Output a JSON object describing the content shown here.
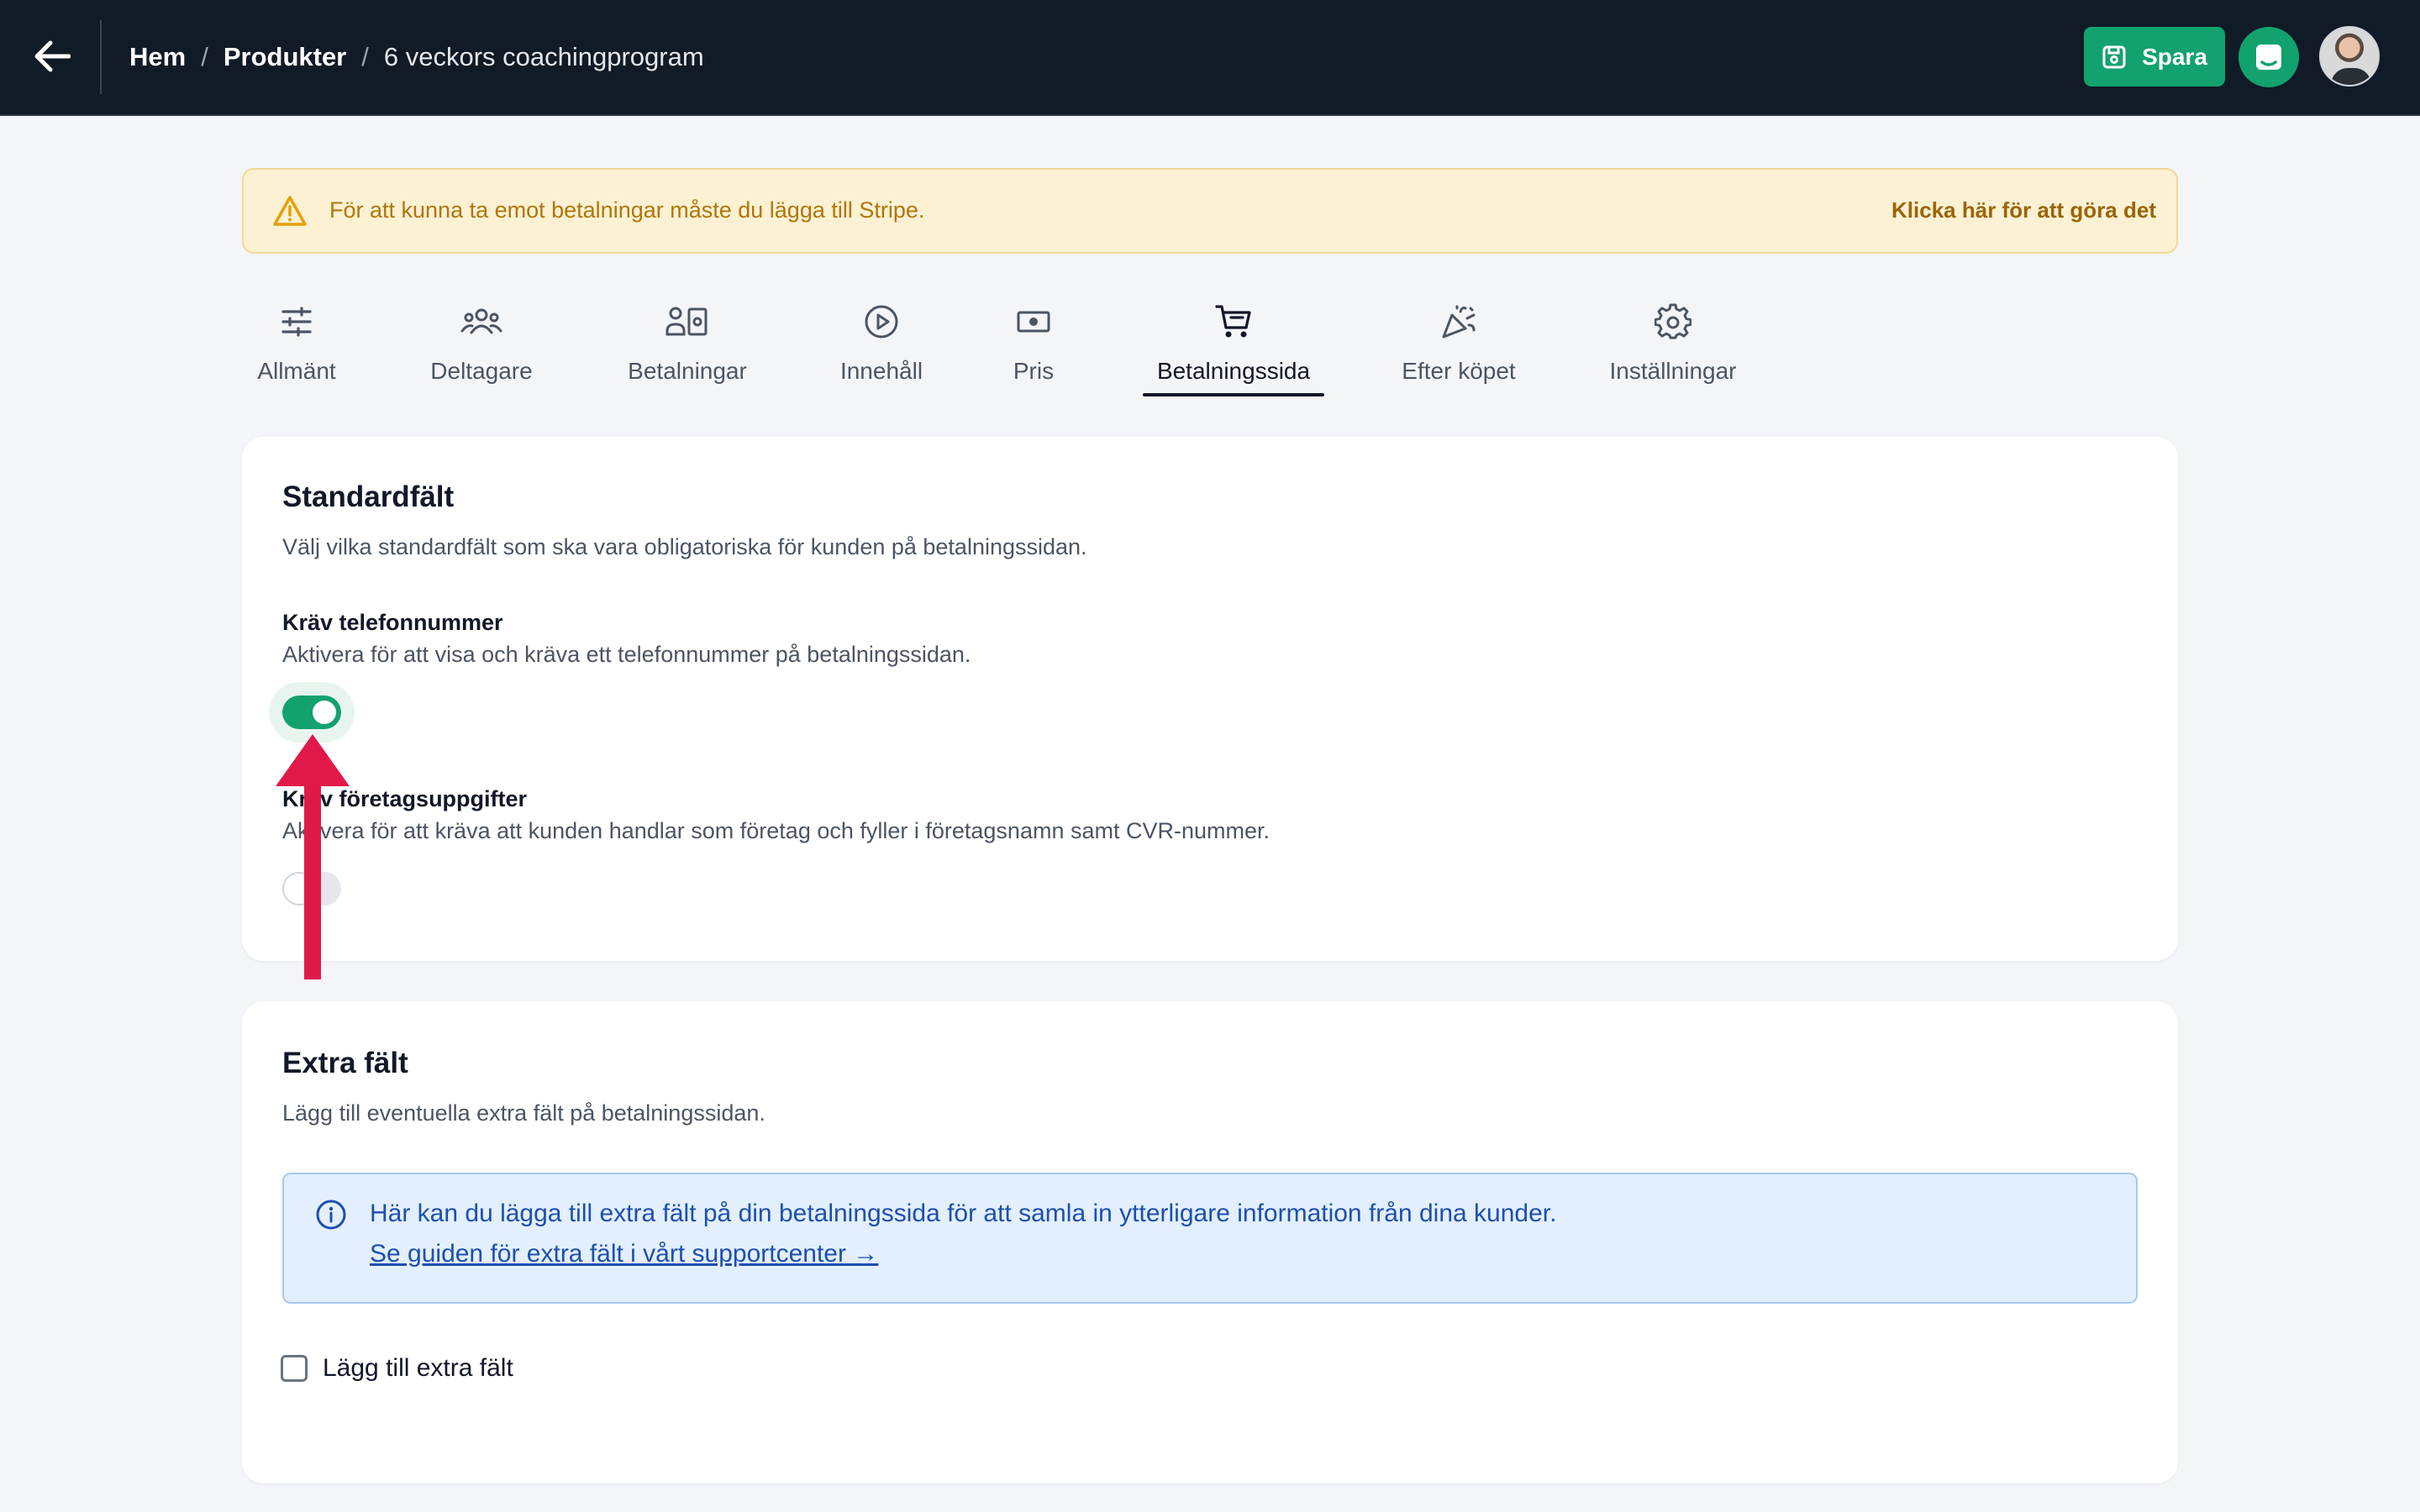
{
  "header": {
    "breadcrumb": [
      "Hem",
      "Produkter",
      "6 veckors coachingprogram"
    ],
    "save_label": "Spara"
  },
  "alert": {
    "text": "För att kunna ta emot betalningar måste du lägga till Stripe.",
    "link": "Klicka här för att göra det"
  },
  "tabs": [
    {
      "label": "Allmänt",
      "icon": "sliders-icon",
      "active": false
    },
    {
      "label": "Deltagare",
      "icon": "users-icon",
      "active": false
    },
    {
      "label": "Betalningar",
      "icon": "payments-icon",
      "active": false
    },
    {
      "label": "Innehåll",
      "icon": "play-icon",
      "active": false
    },
    {
      "label": "Pris",
      "icon": "cash-icon",
      "active": false
    },
    {
      "label": "Betalningssida",
      "icon": "cart-icon",
      "active": true
    },
    {
      "label": "Efter köpet",
      "icon": "party-icon",
      "active": false
    },
    {
      "label": "Inställningar",
      "icon": "gear-icon",
      "active": false
    }
  ],
  "standard_fields": {
    "title": "Standardfält",
    "subtitle": "Välj vilka standardfält som ska vara obligatoriska för kunden på betalningssidan.",
    "phone": {
      "label": "Kräv telefonnummer",
      "description": "Aktivera för att visa och kräva ett telefonnummer på betalningssidan.",
      "enabled": true
    },
    "company": {
      "label": "Kräv företagsuppgifter",
      "description": "Aktivera för att kräva att kunden handlar som företag och fyller i företagsnamn samt CVR-nummer.",
      "enabled": false
    }
  },
  "extra_fields": {
    "title": "Extra fält",
    "subtitle": "Lägg till eventuella extra fält på betalningssidan.",
    "info_text": "Här kan du lägga till extra fält på din betalningssida för att samla in ytterligare information från dina kunder.",
    "info_link": "Se guiden för extra fält i vårt supportcenter →",
    "checkbox_label": "Lägg till extra fält",
    "checked": false
  },
  "colors": {
    "topbar": "#111a27",
    "accent_green": "#12a26d",
    "warning_bg": "#fcf1d3",
    "info_bg": "#e3effd",
    "annotation_arrow": "#e0194a"
  }
}
